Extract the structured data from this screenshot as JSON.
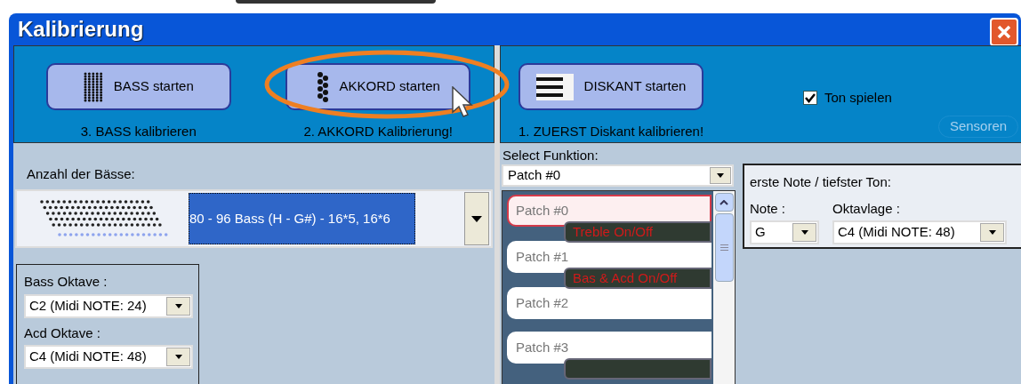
{
  "window": {
    "title": "Kalibrierung"
  },
  "start_buttons": [
    {
      "kind": "bass",
      "label": "BASS starten",
      "hint": "3. BASS kalibrieren"
    },
    {
      "kind": "chord",
      "label": "AKKORD starten",
      "hint": "2. AKKORD Kalibrierung!"
    },
    {
      "kind": "treble",
      "label": "DISKANT starten",
      "hint": "1. ZUERST Diskant kalibrieren!"
    }
  ],
  "play_tone": {
    "label": "Ton spielen",
    "checked": true
  },
  "sensors_button": {
    "label": "Sensoren"
  },
  "bass_count": {
    "label": "Anzahl der Bässe:",
    "value": "80 - 96 Bass (H - G#)  - 16*5, 16*6"
  },
  "octaves": [
    {
      "label": "Bass Oktave :",
      "value": "C2  (Midi NOTE: 24)"
    },
    {
      "label": "Acd Oktave :",
      "value": "C4  (Midi NOTE: 48)"
    }
  ],
  "select_function": {
    "label": "Select Funktion:",
    "value": "Patch #0"
  },
  "patches": [
    {
      "label": "Patch #0",
      "selected": true,
      "kind": "tagged",
      "tag": "Treble  On/Off"
    },
    {
      "label": "Patch #1",
      "selected": false,
      "kind": "tagged",
      "tag": "Bas & Acd On/Off"
    },
    {
      "label": "Patch #2",
      "selected": false,
      "kind": "plain"
    },
    {
      "label": "Patch #3",
      "selected": false,
      "kind": "tagged"
    }
  ],
  "first_note": {
    "title": "erste Note / tiefster Ton:",
    "note_label": "Note :",
    "note_value": "G",
    "octave_label": "Oktavlage :",
    "octave_value": "C4  (Midi NOTE: 48)"
  }
}
